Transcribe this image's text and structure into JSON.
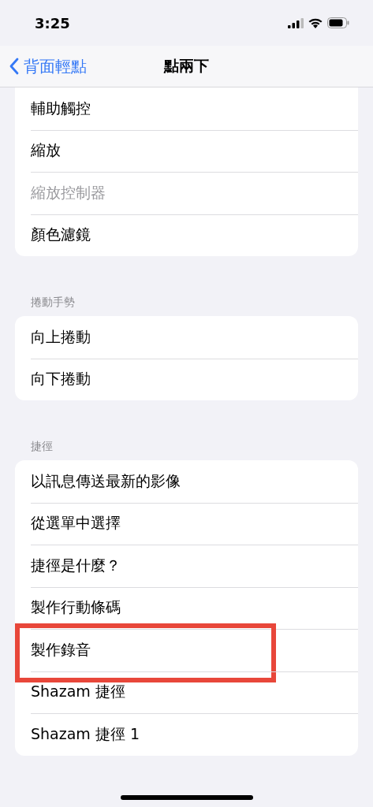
{
  "status_bar": {
    "time": "3:25"
  },
  "nav": {
    "back": "背面輕點",
    "title": "點兩下"
  },
  "sections": [
    {
      "cut_top": true,
      "items": [
        {
          "label": "輔助觸控",
          "disabled": false,
          "highlighted": false
        },
        {
          "label": "縮放",
          "disabled": false,
          "highlighted": false
        },
        {
          "label": "縮放控制器",
          "disabled": true,
          "highlighted": false
        },
        {
          "label": "顏色濾鏡",
          "disabled": false,
          "highlighted": false
        }
      ]
    },
    {
      "header": "捲動手勢",
      "cut_top": false,
      "items": [
        {
          "label": "向上捲動",
          "disabled": false,
          "highlighted": false
        },
        {
          "label": "向下捲動",
          "disabled": false,
          "highlighted": false
        }
      ]
    },
    {
      "header": "捷徑",
      "cut_top": false,
      "items": [
        {
          "label": "以訊息傳送最新的影像",
          "disabled": false,
          "highlighted": false
        },
        {
          "label": "從選單中選擇",
          "disabled": false,
          "highlighted": false
        },
        {
          "label": "捷徑是什麼？",
          "disabled": false,
          "highlighted": false
        },
        {
          "label": "製作行動條碼",
          "disabled": false,
          "highlighted": false
        },
        {
          "label": "製作錄音",
          "disabled": false,
          "highlighted": true
        },
        {
          "label": "Shazam 捷徑",
          "disabled": false,
          "highlighted": false
        },
        {
          "label": "Shazam 捷徑 1",
          "disabled": false,
          "highlighted": false
        }
      ]
    }
  ]
}
